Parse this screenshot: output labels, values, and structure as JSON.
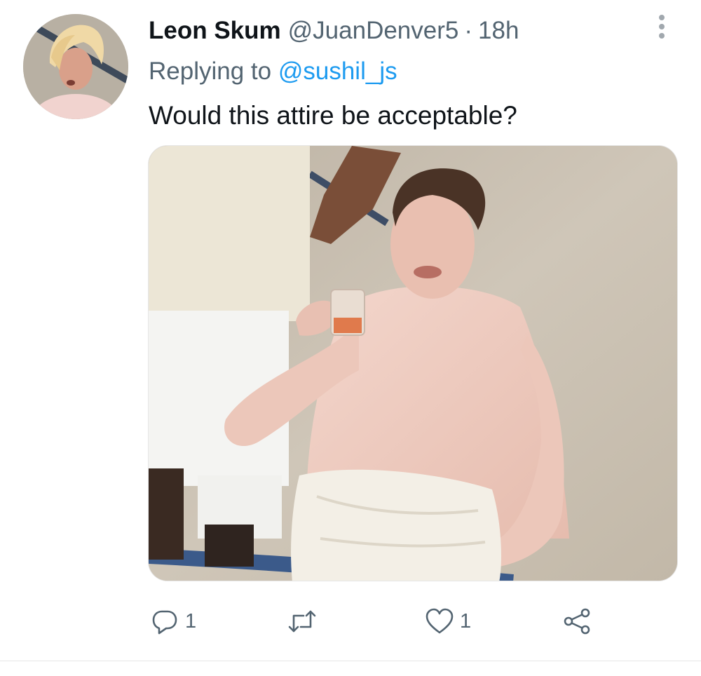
{
  "tweet": {
    "author": {
      "display_name": "Leon Skum",
      "handle": "@JuanDenver5",
      "separator": "·",
      "time": "18h",
      "avatar_icon": "profile-avatar"
    },
    "more_icon": "more-options-icon",
    "reply_prefix": "Replying to",
    "reply_to": "@sushil_js",
    "text": "Would this attire be acceptable?",
    "media": {
      "description_icon": "attached-photo",
      "alt": ""
    },
    "actions": {
      "reply": {
        "icon": "reply-icon",
        "count": "1"
      },
      "retweet": {
        "icon": "retweet-icon",
        "count": ""
      },
      "like": {
        "icon": "like-icon",
        "count": "1"
      },
      "share": {
        "icon": "share-icon"
      }
    }
  },
  "colors": {
    "text_primary": "#0f1419",
    "text_secondary": "#536471",
    "link": "#1d9bf0",
    "icon": "#536471"
  }
}
